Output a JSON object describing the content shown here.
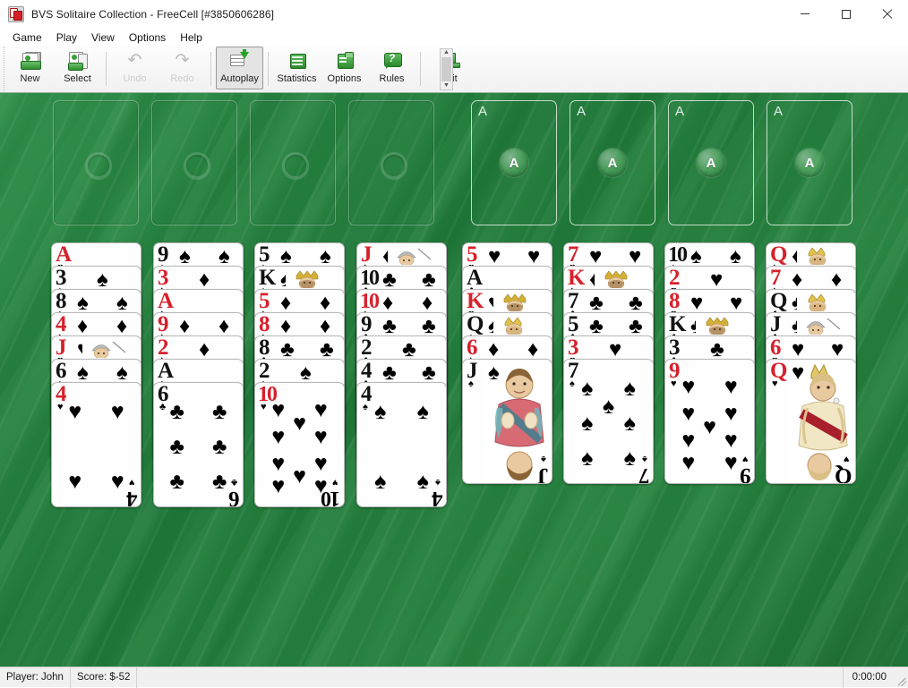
{
  "window": {
    "title": "BVS Solitaire Collection  -  FreeCell [#3850606286]",
    "icon": "cards-icon",
    "minimize_label": "–",
    "maximize_label": "□",
    "close_label": "✕"
  },
  "menubar": {
    "items": [
      {
        "label": "Game"
      },
      {
        "label": "Play"
      },
      {
        "label": "View"
      },
      {
        "label": "Options"
      },
      {
        "label": "Help"
      }
    ]
  },
  "toolbar": {
    "buttons": [
      {
        "label": "New",
        "icon": "new-deal-icon",
        "state": "enabled"
      },
      {
        "label": "Select",
        "icon": "select-game-icon",
        "state": "enabled"
      },
      {
        "label": "Undo",
        "icon": "undo-arrow-icon",
        "state": "disabled"
      },
      {
        "label": "Redo",
        "icon": "redo-arrow-icon",
        "state": "disabled"
      },
      {
        "label": "Autoplay",
        "icon": "autoplay-icon",
        "state": "active"
      },
      {
        "label": "Statistics",
        "icon": "statistics-icon",
        "state": "enabled"
      },
      {
        "label": "Options",
        "icon": "options-icon",
        "state": "enabled"
      },
      {
        "label": "Rules",
        "icon": "rules-icon",
        "state": "enabled"
      },
      {
        "label": "Exit",
        "icon": "exit-icon",
        "state": "enabled"
      }
    ],
    "rules_badge": "?"
  },
  "statusbar": {
    "player": "Player: John",
    "score": "Score: $-52",
    "time": "0:00:00"
  },
  "board": {
    "free_cells": [
      {
        "label": "",
        "empty": true
      },
      {
        "label": "",
        "empty": true
      },
      {
        "label": "",
        "empty": true
      },
      {
        "label": "",
        "empty": true
      }
    ],
    "foundations": [
      {
        "corner": "A",
        "bubble": "A",
        "empty": true
      },
      {
        "corner": "A",
        "bubble": "A",
        "empty": true
      },
      {
        "corner": "A",
        "bubble": "A",
        "empty": true
      },
      {
        "corner": "A",
        "bubble": "A",
        "empty": true
      }
    ],
    "tableau": [
      {
        "cards": [
          {
            "rank": "A",
            "suit": "hearts",
            "color": "red"
          },
          {
            "rank": "3",
            "suit": "spades",
            "color": "black"
          },
          {
            "rank": "8",
            "suit": "spades",
            "color": "black"
          },
          {
            "rank": "4",
            "suit": "diamonds",
            "color": "red"
          },
          {
            "rank": "J",
            "suit": "hearts",
            "color": "red"
          },
          {
            "rank": "6",
            "suit": "spades",
            "color": "black"
          },
          {
            "rank": "4",
            "suit": "hearts",
            "color": "red"
          }
        ]
      },
      {
        "cards": [
          {
            "rank": "9",
            "suit": "spades",
            "color": "black"
          },
          {
            "rank": "3",
            "suit": "diamonds",
            "color": "red"
          },
          {
            "rank": "A",
            "suit": "diamonds",
            "color": "red"
          },
          {
            "rank": "9",
            "suit": "diamonds",
            "color": "red"
          },
          {
            "rank": "2",
            "suit": "diamonds",
            "color": "red"
          },
          {
            "rank": "A",
            "suit": "spades",
            "color": "black"
          },
          {
            "rank": "6",
            "suit": "clubs",
            "color": "black"
          }
        ]
      },
      {
        "cards": [
          {
            "rank": "5",
            "suit": "spades",
            "color": "black"
          },
          {
            "rank": "K",
            "suit": "spades",
            "color": "black"
          },
          {
            "rank": "5",
            "suit": "diamonds",
            "color": "red"
          },
          {
            "rank": "8",
            "suit": "diamonds",
            "color": "red"
          },
          {
            "rank": "8",
            "suit": "clubs",
            "color": "black"
          },
          {
            "rank": "2",
            "suit": "spades",
            "color": "black"
          },
          {
            "rank": "10",
            "suit": "hearts",
            "color": "red"
          }
        ]
      },
      {
        "cards": [
          {
            "rank": "J",
            "suit": "diamonds",
            "color": "red"
          },
          {
            "rank": "10",
            "suit": "clubs",
            "color": "black"
          },
          {
            "rank": "10",
            "suit": "diamonds",
            "color": "red"
          },
          {
            "rank": "9",
            "suit": "clubs",
            "color": "black"
          },
          {
            "rank": "2",
            "suit": "clubs",
            "color": "black"
          },
          {
            "rank": "4",
            "suit": "clubs",
            "color": "black"
          },
          {
            "rank": "4",
            "suit": "spades",
            "color": "black"
          }
        ]
      },
      {
        "cards": [
          {
            "rank": "5",
            "suit": "hearts",
            "color": "red"
          },
          {
            "rank": "A",
            "suit": "clubs",
            "color": "black"
          },
          {
            "rank": "K",
            "suit": "hearts",
            "color": "red"
          },
          {
            "rank": "Q",
            "suit": "spades",
            "color": "black"
          },
          {
            "rank": "6",
            "suit": "diamonds",
            "color": "red"
          },
          {
            "rank": "J",
            "suit": "spades",
            "color": "black"
          }
        ]
      },
      {
        "cards": [
          {
            "rank": "7",
            "suit": "hearts",
            "color": "red"
          },
          {
            "rank": "K",
            "suit": "diamonds",
            "color": "red"
          },
          {
            "rank": "7",
            "suit": "clubs",
            "color": "black"
          },
          {
            "rank": "5",
            "suit": "clubs",
            "color": "black"
          },
          {
            "rank": "3",
            "suit": "hearts",
            "color": "red"
          },
          {
            "rank": "7",
            "suit": "spades",
            "color": "black"
          }
        ]
      },
      {
        "cards": [
          {
            "rank": "10",
            "suit": "spades",
            "color": "black"
          },
          {
            "rank": "2",
            "suit": "hearts",
            "color": "red"
          },
          {
            "rank": "8",
            "suit": "hearts",
            "color": "red"
          },
          {
            "rank": "K",
            "suit": "clubs",
            "color": "black"
          },
          {
            "rank": "3",
            "suit": "clubs",
            "color": "black"
          },
          {
            "rank": "9",
            "suit": "hearts",
            "color": "red"
          }
        ]
      },
      {
        "cards": [
          {
            "rank": "Q",
            "suit": "diamonds",
            "color": "red"
          },
          {
            "rank": "7",
            "suit": "diamonds",
            "color": "red"
          },
          {
            "rank": "Q",
            "suit": "clubs",
            "color": "black"
          },
          {
            "rank": "J",
            "suit": "clubs",
            "color": "black"
          },
          {
            "rank": "6",
            "suit": "hearts",
            "color": "red"
          },
          {
            "rank": "Q",
            "suit": "hearts",
            "color": "red"
          }
        ]
      }
    ]
  },
  "colors": {
    "felt_green": "#27853f",
    "red_suit": "#d7212c",
    "black_suit": "#121212",
    "toolbar_bg": "#f1f1f1",
    "status_bg": "#f0f0f0"
  }
}
